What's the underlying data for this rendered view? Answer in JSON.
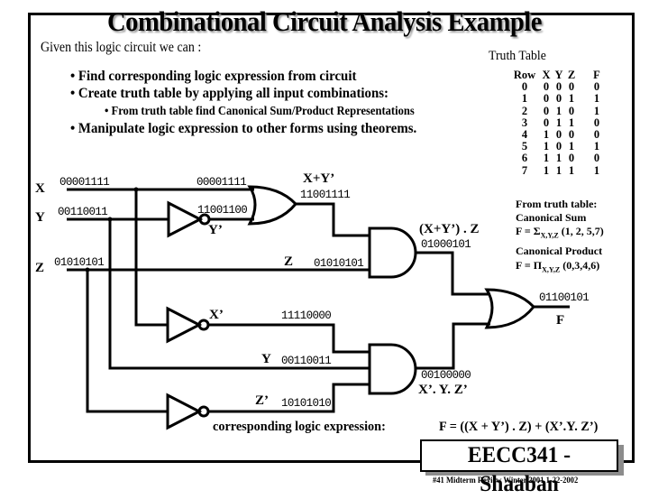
{
  "title": "Combinational Circuit Analysis Example",
  "intro": "Given this logic circuit we can :",
  "bullets": [
    "• Find corresponding logic expression from circuit",
    "• Create truth table by applying all input combinations:",
    "• From truth table find Canonical Sum/Product  Representations",
    "• Manipulate logic expression to other forms using theorems."
  ],
  "truth_table": {
    "title": "Truth Table",
    "headers": [
      "Row",
      "X",
      "Y",
      "Z",
      "F"
    ],
    "rows": [
      [
        "0",
        "0",
        "0",
        "0",
        "0"
      ],
      [
        "1",
        "0",
        "0",
        "1",
        "1"
      ],
      [
        "2",
        "0",
        "1",
        "0",
        "1"
      ],
      [
        "3",
        "0",
        "1",
        "1",
        "0"
      ],
      [
        "4",
        "1",
        "0",
        "0",
        "0"
      ],
      [
        "5",
        "1",
        "0",
        "1",
        "1"
      ],
      [
        "6",
        "1",
        "1",
        "0",
        "0"
      ],
      [
        "7",
        "1",
        "1",
        "1",
        "1"
      ]
    ]
  },
  "canonical": {
    "from_label": "From truth table:",
    "sum_title": "Canonical Sum",
    "sum_prefix": "F = ",
    "sum_symbol": "Σ",
    "sum_vars": "X,Y,Z",
    "sum_terms": " (1, 2, 5,7)",
    "product_title": "Canonical Product",
    "product_prefix": "F = ",
    "product_symbol": "Π",
    "product_vars": "X,Y,Z",
    "product_terms": " (0,3,4,6)"
  },
  "circuit": {
    "inputs": [
      {
        "name": "X",
        "value": "00001111"
      },
      {
        "name": "Y",
        "value": "00110011"
      },
      {
        "name": "Z",
        "value": "01010101"
      }
    ],
    "or1_in_x": "00001111",
    "not_y_value": "11001100",
    "not_y_label": "Y’",
    "or1_label": "X+Y’",
    "or1_value": "11001111",
    "z_label": "Z",
    "z_value": "01010101",
    "and1_label": "(X+Y’) . Z",
    "and1_value": "01000101",
    "not_x_label": "X’",
    "not_x_value": "11110000",
    "y_label": "Y",
    "y_value": "00110011",
    "not_z_label": "Z’",
    "not_z_value": "10101010",
    "and2_value": "00100000",
    "and2_label": "X’. Y. Z’",
    "or2_value": "01100101",
    "output_label": "F"
  },
  "expression": {
    "label": "corresponding logic expression:",
    "value": "F = ((X + Y’) . Z) + (X’.Y. Z’)"
  },
  "badge": "EECC341 - Shaaban",
  "footnote": "#41   Midterm Review   Winter 2001  1-22-2002"
}
